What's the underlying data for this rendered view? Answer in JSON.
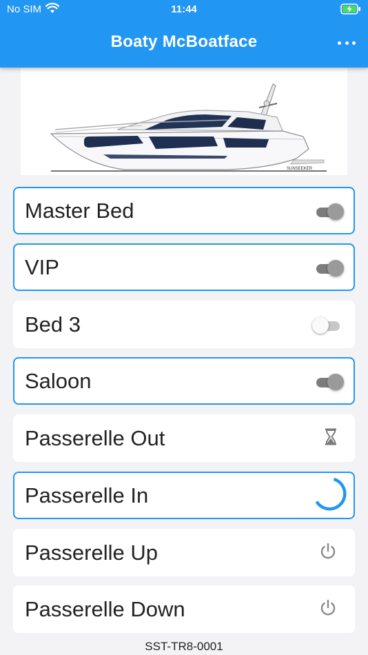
{
  "status_bar": {
    "carrier": "No SIM",
    "time": "11:44"
  },
  "app_bar": {
    "title": "Boaty McBoatface",
    "menu_icon": "more-horiz-icon"
  },
  "boat_image": {
    "caption": "SUNSEEKER"
  },
  "accent_color": "#2196f3",
  "tiles": [
    {
      "label": "Master Bed",
      "control": "switch",
      "state": "on"
    },
    {
      "label": "VIP",
      "control": "switch",
      "state": "on"
    },
    {
      "label": "Bed 3",
      "control": "switch",
      "state": "off"
    },
    {
      "label": "Saloon",
      "control": "switch",
      "state": "on"
    },
    {
      "label": "Passerelle Out",
      "control": "hourglass-icon",
      "state": "waiting"
    },
    {
      "label": "Passerelle In",
      "control": "progress-spinner",
      "state": "active"
    },
    {
      "label": "Passerelle Up",
      "control": "power-icon",
      "state": "idle"
    },
    {
      "label": "Passerelle Down",
      "control": "power-icon",
      "state": "idle"
    }
  ],
  "footer": {
    "device_id": "SST-TR8-0001"
  }
}
